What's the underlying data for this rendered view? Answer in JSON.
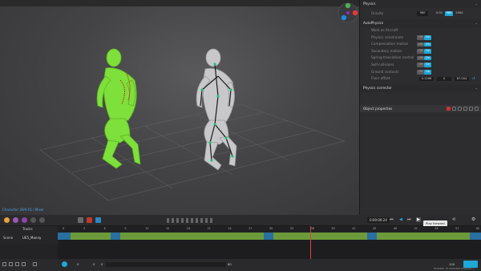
{
  "viewport": {
    "caption": "Character: BVH 01 / Mixer"
  },
  "panel": {
    "physics": {
      "title": "Physics",
      "gravity_label": "Gravity",
      "gravity_values": [
        "980",
        "0.01",
        "980",
        "2000"
      ]
    },
    "autophysics": {
      "title": "AutoPhysics",
      "rows": [
        {
          "label": "Work as Aircraft",
          "off": "",
          "on": ""
        },
        {
          "label": "Physics constraints",
          "off": "Off",
          "on": "On"
        },
        {
          "label": "Compensation motion",
          "off": "Off",
          "on": "On"
        },
        {
          "label": "Secondary motion",
          "off": "Off",
          "on": "On"
        },
        {
          "label": "Spring translation control",
          "off": "Off",
          "on": "On"
        },
        {
          "label": "Self-collisions",
          "off": "Off",
          "on": "On"
        },
        {
          "label": "Ground contacts",
          "off": "Off",
          "on": "On"
        }
      ],
      "floor_label": "Floor offset",
      "floor_values": [
        "0.1266",
        "0",
        "87.004"
      ]
    },
    "corrector_title": "Physics corrector",
    "object_properties": "Object properties"
  },
  "timeline": {
    "time": "0:00:00:24",
    "tooltip": "Play forward",
    "tracks_label": "Tracks",
    "scene_label": "Scene",
    "track_name": "UE5_Manny",
    "ruler": [
      "0",
      "3",
      "6",
      "9",
      "12",
      "15",
      "18",
      "21",
      "24",
      "27",
      "30",
      "33",
      "36",
      "39",
      "42",
      "45",
      "48",
      "51",
      "54",
      "57",
      "60"
    ],
    "bottom": {
      "frame_start": "0",
      "frame_a": "0",
      "frame_b": "0",
      "fps": "60",
      "zoom": "100",
      "status": "Number of selected objects: 1"
    }
  },
  "colors": {
    "accent": "#1ea7d8",
    "clip_green": "#6c9a3a",
    "clip_blue": "#2a6fa0",
    "playhead": "#e04040",
    "char_green": "#7ee03a"
  }
}
